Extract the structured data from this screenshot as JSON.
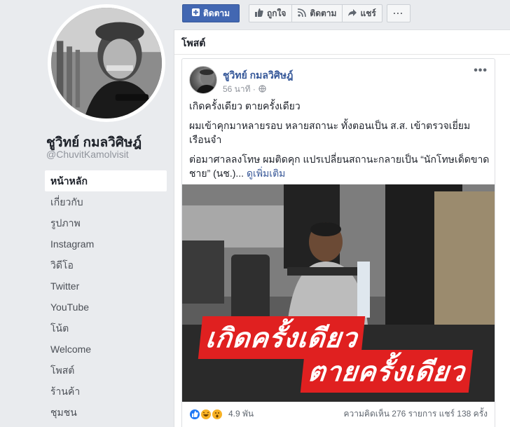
{
  "sidebar": {
    "page_name": "ชูวิทย์ กมลวิศิษฎ์",
    "handle": "@ChuvitKamolvisit",
    "nav": [
      {
        "label": "หน้าหลัก",
        "active": true
      },
      {
        "label": "เกี่ยวกับ"
      },
      {
        "label": "รูปภาพ"
      },
      {
        "label": "Instagram"
      },
      {
        "label": "วิดีโอ"
      },
      {
        "label": "Twitter"
      },
      {
        "label": "YouTube"
      },
      {
        "label": "โน้ต"
      },
      {
        "label": "Welcome"
      },
      {
        "label": "โพสต์"
      },
      {
        "label": "ร้านค้า"
      },
      {
        "label": "ชุมชน"
      }
    ]
  },
  "topbar": {
    "follow_label": "ติดตาม",
    "like_label": "ถูกใจ",
    "following_label": "ติดตาม",
    "share_label": "แชร์",
    "more_label": "···"
  },
  "main": {
    "section_title": "โพสต์"
  },
  "post": {
    "author": "ชูวิทย์ กมลวิศิษฎ์",
    "time": "56 นาที ·",
    "more": "•••",
    "paragraphs": [
      "เกิดครั้งเดียว ตายครั้งเดียว",
      "ผมเข้าคุกมาหลายรอบ หลายสถานะ ทั้งตอนเป็น ส.ส. เข้าตรวจเยี่ยมเรือนจำ",
      "ต่อมาศาลลงโทษ ผมติดคุก แปรเปลี่ยนสถานะกลายเป็น “นักโทษเด็ดขาดชาย” (นช.)..."
    ],
    "see_more": "ดูเพิ่มเติม",
    "image_caption_1": "เกิดครั้งเดียว",
    "image_caption_2": "ตายครั้งเดียว",
    "reaction_count": "4.9 พัน",
    "engagement": "ความคิดเห็น 276 รายการ  แชร์ 138 ครั้ง"
  },
  "colors": {
    "brand": "#4267b2",
    "link": "#365899",
    "caption_red": "#e02020"
  }
}
